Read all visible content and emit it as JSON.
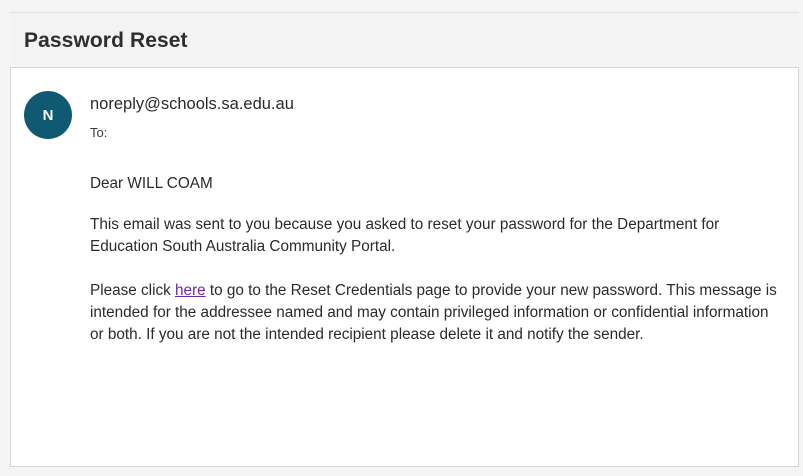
{
  "email": {
    "subject": "Password Reset",
    "avatar_initial": "N",
    "from": "noreply@schools.sa.edu.au",
    "to_label": "To:",
    "salutation": "Dear WILL COAM",
    "paragraph1": "This email was sent to you because you asked to reset your password for the Department for Education South Australia Community Portal.",
    "paragraph2_before_link": "Please click ",
    "link_text": "here",
    "paragraph2_after_link": " to go to the Reset Credentials page to provide your new password. This message is intended for the addressee named and may contain privileged information or confidential information or both. If you are not the intended recipient please delete it and notify the sender."
  },
  "colors": {
    "avatar_bg": "#0f5a72",
    "link": "#6b2aa6"
  }
}
